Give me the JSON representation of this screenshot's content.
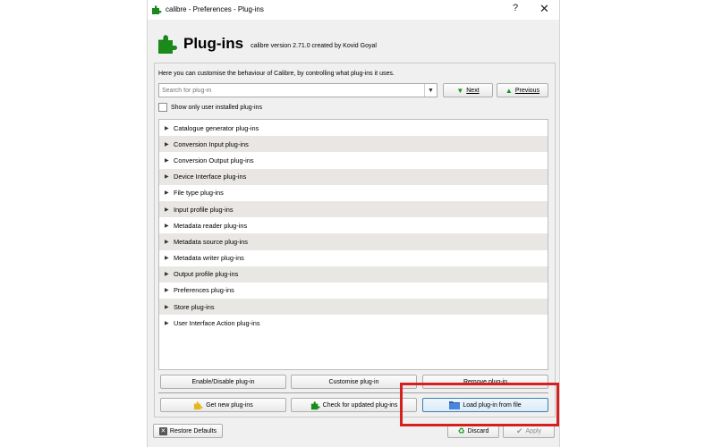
{
  "window": {
    "title": "calibre - Preferences - Plug-ins",
    "help_glyph": "?",
    "close_glyph": "✕"
  },
  "header": {
    "heading": "Plug-ins",
    "version": "calibre version 2.71.0 created by Kovid Goyal"
  },
  "intro_text": "Here you can customise the behaviour of Calibre, by controlling what plug-ins it uses.",
  "search": {
    "placeholder": "Search for plug-in",
    "value": ""
  },
  "nav": {
    "next_label": "Next",
    "previous_label": "Previous"
  },
  "filter": {
    "checkbox_label": "Show only user installed plug-ins",
    "checked": false
  },
  "plugin_categories": [
    "Catalogue generator plug-ins",
    "Conversion Input plug-ins",
    "Conversion Output plug-ins",
    "Device Interface plug-ins",
    "File type plug-ins",
    "Input profile plug-ins",
    "Metadata reader plug-ins",
    "Metadata source plug-ins",
    "Metadata writer plug-ins",
    "Output profile plug-ins",
    "Preferences plug-ins",
    "Store plug-ins",
    "User Interface Action plug-ins"
  ],
  "actions": {
    "enable_disable": "Enable/Disable plug-in",
    "customise": "Customise plug-in",
    "remove": "Remove plug-in",
    "get_new": "Get new plug-ins",
    "check_updates": "Check for updated plug-ins",
    "load_from_file": "Load plug-in from file"
  },
  "footer": {
    "restore_defaults": "Restore Defaults",
    "discard": "Discard",
    "apply": "Apply"
  },
  "colors": {
    "accent_green": "#0a9a19",
    "highlight_red": "#d62020"
  }
}
